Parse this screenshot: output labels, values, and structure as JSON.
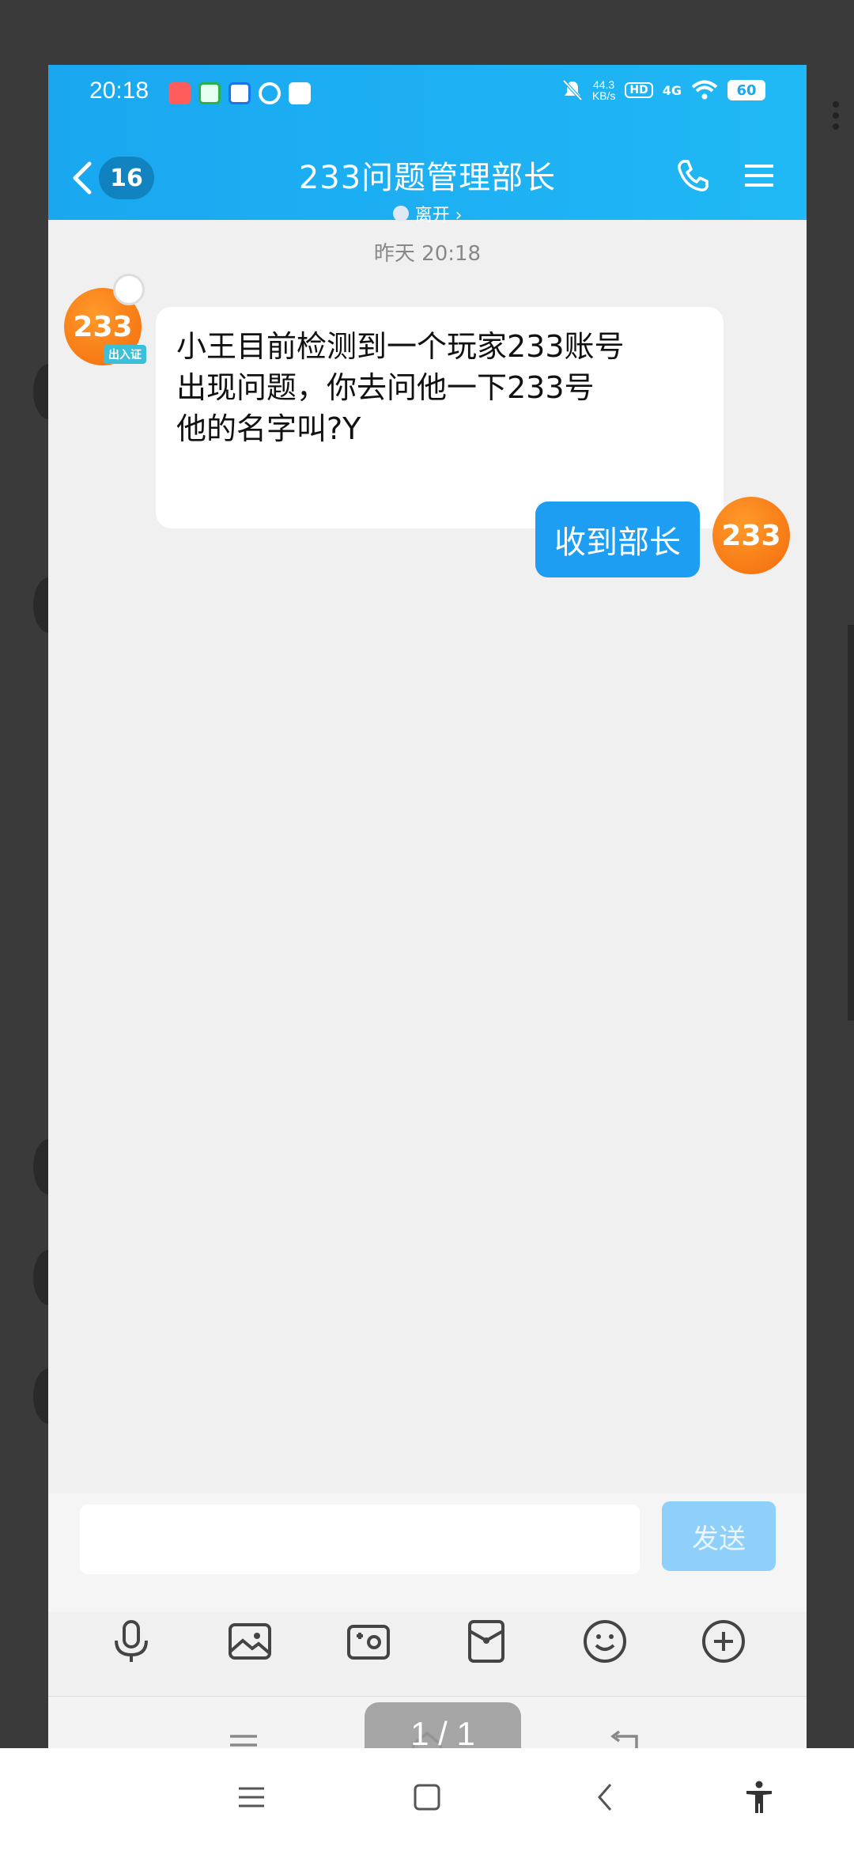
{
  "status_bar": {
    "time": "20:18",
    "net_speed": "44.3",
    "net_unit": "KB/s",
    "hd_label": "HD",
    "signal_label": "4G",
    "battery": "60"
  },
  "nav": {
    "unread_count": "16",
    "title": "233问题管理部长",
    "status": "离开 ›"
  },
  "chat": {
    "timestamp": "昨天 20:18",
    "messages": [
      {
        "side": "left",
        "avatar_text": "233",
        "avatar_tag": "出入证",
        "text_lines": [
          "小王目前检测到一个玩家233账号",
          "出现问题，你去问他一下233号",
          "他的名字叫?Y"
        ]
      },
      {
        "side": "right",
        "avatar_text": "233",
        "text": "收到部长"
      }
    ]
  },
  "input": {
    "value": "",
    "placeholder": "",
    "send_label": "发送"
  },
  "toolbar": {
    "items": [
      "mic-icon",
      "image-icon",
      "camera-icon",
      "red-packet-icon",
      "emoji-icon",
      "plus-icon"
    ]
  },
  "page_indicator": "1 / 1"
}
